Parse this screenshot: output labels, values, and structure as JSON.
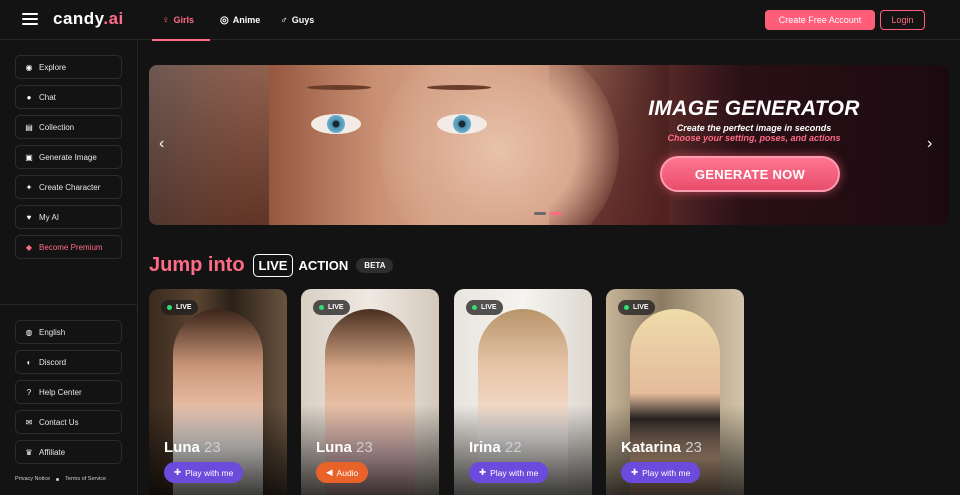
{
  "app": {
    "logo_main": "candy",
    "logo_accent": ".ai"
  },
  "topnav": {
    "tabs": [
      {
        "label": "Girls",
        "icon": "♀",
        "active": true
      },
      {
        "label": "Anime",
        "icon": "◎",
        "active": false
      },
      {
        "label": "Guys",
        "icon": "♂",
        "active": false
      }
    ],
    "create_account": "Create Free Account",
    "login": "Login"
  },
  "sidebar": {
    "items": [
      {
        "label": "Explore",
        "icon": "compass-icon"
      },
      {
        "label": "Chat",
        "icon": "chat-icon"
      },
      {
        "label": "Collection",
        "icon": "collection-icon"
      },
      {
        "label": "Generate Image",
        "icon": "image-icon"
      },
      {
        "label": "Create Character",
        "icon": "wand-icon"
      },
      {
        "label": "My AI",
        "icon": "heart-icon"
      },
      {
        "label": "Become Premium",
        "icon": "diamond-icon"
      }
    ],
    "bottom_items": [
      {
        "label": "English",
        "icon": "flag-icon"
      },
      {
        "label": "Discord",
        "icon": "discord-icon"
      },
      {
        "label": "Help Center",
        "icon": "help-icon"
      },
      {
        "label": "Contact Us",
        "icon": "mail-icon"
      },
      {
        "label": "Affiliate",
        "icon": "trophy-icon"
      }
    ],
    "legal": {
      "privacy": "Privacy Notice",
      "terms": "Terms of Service"
    }
  },
  "banner": {
    "title": "IMAGE GENERATOR",
    "subtitle": "Create the perfect image in seconds",
    "subtitle2": "Choose your setting, poses, and actions",
    "cta": "GENERATE NOW"
  },
  "live_section": {
    "jump": "Jump into",
    "live": "LIVE",
    "action": "ACTION",
    "beta": "BETA"
  },
  "cards": [
    {
      "name": "Luna",
      "age": "23",
      "badge": "LIVE",
      "button": "Play with me",
      "button_type": "play"
    },
    {
      "name": "Luna",
      "age": "23",
      "badge": "LIVE",
      "button": "Audio",
      "button_type": "audio"
    },
    {
      "name": "Irina",
      "age": "22",
      "badge": "LIVE",
      "button": "Play with me",
      "button_type": "play"
    },
    {
      "name": "Katarina",
      "age": "23",
      "badge": "LIVE",
      "button": "Play with me",
      "button_type": "play"
    }
  ],
  "colors": {
    "accent": "#ff5d7a",
    "play_button": "#6a4bdc",
    "audio_button": "#e8622a",
    "live_dot": "#2fe070"
  }
}
